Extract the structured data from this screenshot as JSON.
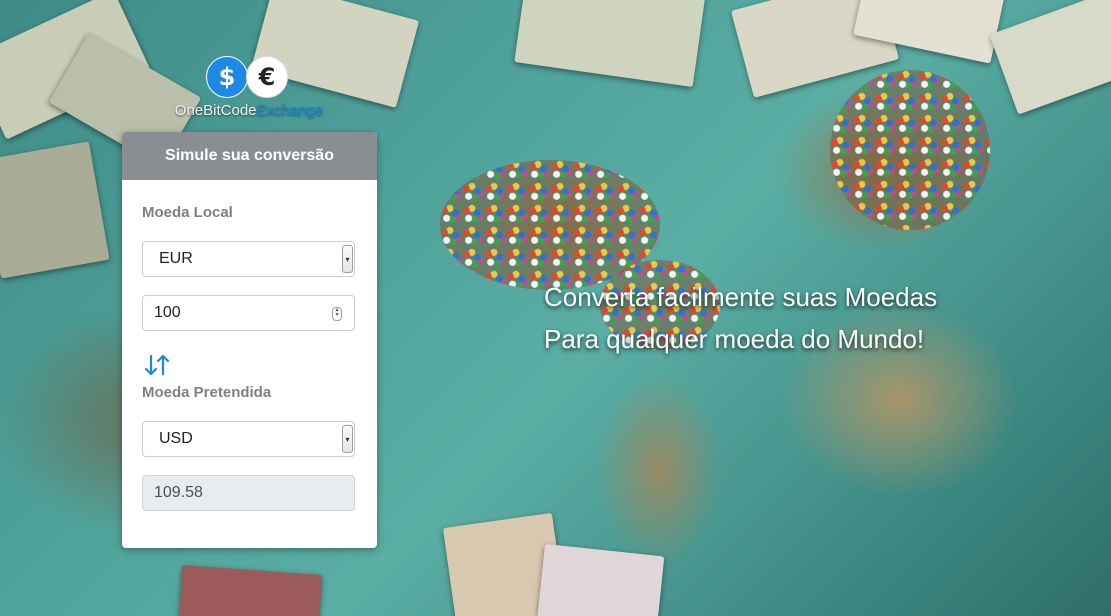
{
  "brand": {
    "dollar_symbol": "$",
    "euro_symbol": "€",
    "name_part1": "OneBitCode",
    "name_part2": "Exchange",
    "accent_color": "#1e88e5"
  },
  "converter": {
    "title": "Simule sua conversão",
    "local_currency_label": "Moeda Local",
    "local_currency_value": "EUR",
    "amount_value": "100",
    "swap_icon": "swap-vertical-arrows-icon",
    "target_currency_label": "Moeda Pretendida",
    "target_currency_value": "USD",
    "result_value": "109.58"
  },
  "hero": {
    "line1": "Converta facilmente suas Moedas",
    "line2": "Para qualquer moeda do Mundo!"
  }
}
